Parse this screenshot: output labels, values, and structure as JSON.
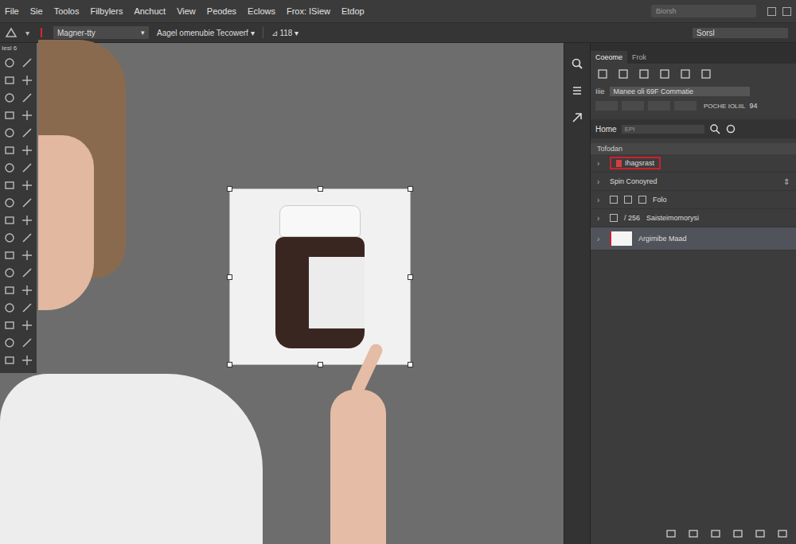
{
  "menu": [
    "File",
    "Sie",
    "Toolos",
    "Filbylers",
    "Anchuct",
    "View",
    "Peodes",
    "Eclows",
    "Frox: ISiew",
    "Etdop"
  ],
  "search": {
    "placeholder": "Biorsh"
  },
  "options_bar": {
    "tool_preset": "Magner-tty",
    "mode": "Aagel omenubie Tecowerf ▾",
    "size": "⊿ 118 ▾",
    "workspace": "Sorsl"
  },
  "toolbar": {
    "label": "Iesl 6"
  },
  "panel": {
    "tabs": [
      {
        "label": "Coeome",
        "selected": true
      },
      {
        "label": "Frok",
        "selected": false
      }
    ],
    "preset_label": "Iiie",
    "preset_value": "Manee oli 69F Commatie",
    "row_value": "POCHE IOLIIL",
    "row_number": "94",
    "home": "Home",
    "home_field": "EPI",
    "section": "Tofodan",
    "layers": [
      {
        "label": "Ihagsrast",
        "kind": "layer",
        "annotated": true,
        "selected": false
      },
      {
        "label": "Spin Conoyred",
        "kind": "group",
        "annotated": false,
        "selected": false
      },
      {
        "label": "Folo",
        "kind": "tools",
        "annotated": false,
        "selected": false
      },
      {
        "label": "Saisteimomorysi",
        "count": "/ 256",
        "kind": "count",
        "annotated": false,
        "selected": false
      },
      {
        "label": "Argimibe Maad",
        "kind": "thumb",
        "annotated": false,
        "selected": true
      }
    ]
  }
}
